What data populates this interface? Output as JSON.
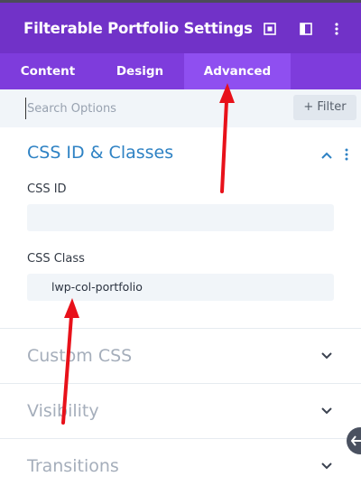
{
  "header": {
    "title": "Filterable Portfolio Settings"
  },
  "icons": {
    "expand": "expand-icon",
    "sidebar": "sidebar-layout-icon",
    "more": "more-vertical-icon"
  },
  "tabs": [
    {
      "label": "Content"
    },
    {
      "label": "Design"
    },
    {
      "label": "Advanced",
      "active": true
    }
  ],
  "search": {
    "placeholder": "Search Options",
    "filter_label": "+ Filter"
  },
  "sections": {
    "css": {
      "title": "CSS ID & Classes",
      "fields": {
        "css_id": {
          "label": "CSS ID",
          "value": ""
        },
        "css_class": {
          "label": "CSS Class",
          "value": "lwp-col-portfolio"
        }
      }
    },
    "custom_css": {
      "title": "Custom CSS"
    },
    "visibility": {
      "title": "Visibility"
    },
    "transitions": {
      "title": "Transitions"
    }
  },
  "colors": {
    "header_bg": "#7132c8",
    "tabs_bg": "#7e3cdc",
    "active_tab_bg": "#8f4ff0",
    "open_section_title": "#2e82c4",
    "annotation_arrow": "#e8111a"
  }
}
